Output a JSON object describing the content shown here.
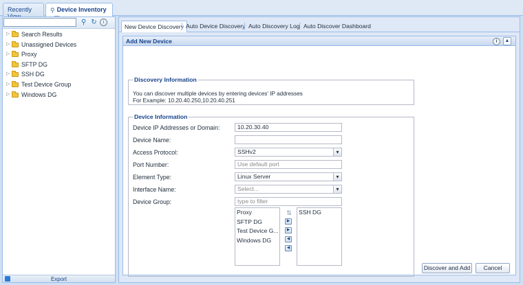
{
  "top_tabs": [
    {
      "label": "Recently View"
    },
    {
      "label": "Device Inventory",
      "close": "x"
    }
  ],
  "left_panel": {
    "search_placeholder": "",
    "tree": [
      {
        "label": "Search Results",
        "expandable": true
      },
      {
        "label": "Unassigned Devices",
        "expandable": true
      },
      {
        "label": "Proxy",
        "expandable": true
      },
      {
        "label": "SFTP DG",
        "expandable": false
      },
      {
        "label": "SSH DG",
        "expandable": true
      },
      {
        "label": "Test Device Group",
        "expandable": true
      },
      {
        "label": "Windows DG",
        "expandable": true
      }
    ],
    "export_label": "Export"
  },
  "sub_tabs": [
    {
      "label": "New Device Discovery"
    },
    {
      "label": "Auto Device Discovery"
    },
    {
      "label": "Auto Discovery Log"
    },
    {
      "label": "Auto Discover Dashboard"
    }
  ],
  "panel": {
    "title": "Add New Device",
    "discovery": {
      "legend": "Discovery Information",
      "line1": "You can discover multiple devices by entering devices' IP addresses",
      "line2": "For Example: 10.20.40.250,10.20.40.251"
    },
    "device": {
      "legend": "Device Information",
      "ip_label": "Device IP Addresses or Domain:",
      "ip_value": "10.20.30.40",
      "name_label": "Device Name:",
      "name_value": "",
      "protocol_label": "Access Protocol:",
      "protocol_value": "SSHv2",
      "port_label": "Port Number:",
      "port_placeholder": "Use default port",
      "element_label": "Element Type:",
      "element_value": "Linux Server",
      "interface_label": "Interface Name:",
      "interface_placeholder": "Select...",
      "group_label": "Device Group:",
      "group_filter_placeholder": "type to filter",
      "available_groups": [
        "Proxy",
        "SFTP DG",
        "Test Device G...",
        "Windows DG"
      ],
      "selected_groups": [
        "SSH DG"
      ]
    },
    "buttons": {
      "discover": "Discover and Add",
      "cancel": "Cancel"
    }
  },
  "colors": {
    "accent": "#15428b",
    "border": "#99bbe8",
    "folder": "#f0c53a"
  }
}
